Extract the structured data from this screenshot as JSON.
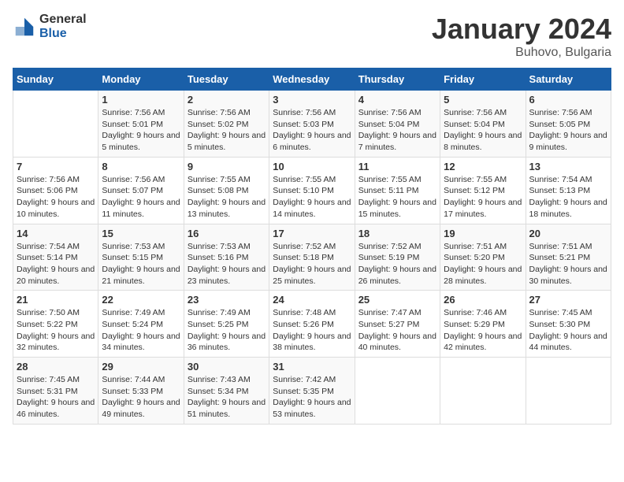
{
  "header": {
    "logo_general": "General",
    "logo_blue": "Blue",
    "month_title": "January 2024",
    "location": "Buhovo, Bulgaria"
  },
  "weekdays": [
    "Sunday",
    "Monday",
    "Tuesday",
    "Wednesday",
    "Thursday",
    "Friday",
    "Saturday"
  ],
  "weeks": [
    [
      {
        "day": "",
        "sunrise": "",
        "sunset": "",
        "daylight": ""
      },
      {
        "day": "1",
        "sunrise": "Sunrise: 7:56 AM",
        "sunset": "Sunset: 5:01 PM",
        "daylight": "Daylight: 9 hours and 5 minutes."
      },
      {
        "day": "2",
        "sunrise": "Sunrise: 7:56 AM",
        "sunset": "Sunset: 5:02 PM",
        "daylight": "Daylight: 9 hours and 5 minutes."
      },
      {
        "day": "3",
        "sunrise": "Sunrise: 7:56 AM",
        "sunset": "Sunset: 5:03 PM",
        "daylight": "Daylight: 9 hours and 6 minutes."
      },
      {
        "day": "4",
        "sunrise": "Sunrise: 7:56 AM",
        "sunset": "Sunset: 5:04 PM",
        "daylight": "Daylight: 9 hours and 7 minutes."
      },
      {
        "day": "5",
        "sunrise": "Sunrise: 7:56 AM",
        "sunset": "Sunset: 5:04 PM",
        "daylight": "Daylight: 9 hours and 8 minutes."
      },
      {
        "day": "6",
        "sunrise": "Sunrise: 7:56 AM",
        "sunset": "Sunset: 5:05 PM",
        "daylight": "Daylight: 9 hours and 9 minutes."
      }
    ],
    [
      {
        "day": "7",
        "sunrise": "Sunrise: 7:56 AM",
        "sunset": "Sunset: 5:06 PM",
        "daylight": "Daylight: 9 hours and 10 minutes."
      },
      {
        "day": "8",
        "sunrise": "Sunrise: 7:56 AM",
        "sunset": "Sunset: 5:07 PM",
        "daylight": "Daylight: 9 hours and 11 minutes."
      },
      {
        "day": "9",
        "sunrise": "Sunrise: 7:55 AM",
        "sunset": "Sunset: 5:08 PM",
        "daylight": "Daylight: 9 hours and 13 minutes."
      },
      {
        "day": "10",
        "sunrise": "Sunrise: 7:55 AM",
        "sunset": "Sunset: 5:10 PM",
        "daylight": "Daylight: 9 hours and 14 minutes."
      },
      {
        "day": "11",
        "sunrise": "Sunrise: 7:55 AM",
        "sunset": "Sunset: 5:11 PM",
        "daylight": "Daylight: 9 hours and 15 minutes."
      },
      {
        "day": "12",
        "sunrise": "Sunrise: 7:55 AM",
        "sunset": "Sunset: 5:12 PM",
        "daylight": "Daylight: 9 hours and 17 minutes."
      },
      {
        "day": "13",
        "sunrise": "Sunrise: 7:54 AM",
        "sunset": "Sunset: 5:13 PM",
        "daylight": "Daylight: 9 hours and 18 minutes."
      }
    ],
    [
      {
        "day": "14",
        "sunrise": "Sunrise: 7:54 AM",
        "sunset": "Sunset: 5:14 PM",
        "daylight": "Daylight: 9 hours and 20 minutes."
      },
      {
        "day": "15",
        "sunrise": "Sunrise: 7:53 AM",
        "sunset": "Sunset: 5:15 PM",
        "daylight": "Daylight: 9 hours and 21 minutes."
      },
      {
        "day": "16",
        "sunrise": "Sunrise: 7:53 AM",
        "sunset": "Sunset: 5:16 PM",
        "daylight": "Daylight: 9 hours and 23 minutes."
      },
      {
        "day": "17",
        "sunrise": "Sunrise: 7:52 AM",
        "sunset": "Sunset: 5:18 PM",
        "daylight": "Daylight: 9 hours and 25 minutes."
      },
      {
        "day": "18",
        "sunrise": "Sunrise: 7:52 AM",
        "sunset": "Sunset: 5:19 PM",
        "daylight": "Daylight: 9 hours and 26 minutes."
      },
      {
        "day": "19",
        "sunrise": "Sunrise: 7:51 AM",
        "sunset": "Sunset: 5:20 PM",
        "daylight": "Daylight: 9 hours and 28 minutes."
      },
      {
        "day": "20",
        "sunrise": "Sunrise: 7:51 AM",
        "sunset": "Sunset: 5:21 PM",
        "daylight": "Daylight: 9 hours and 30 minutes."
      }
    ],
    [
      {
        "day": "21",
        "sunrise": "Sunrise: 7:50 AM",
        "sunset": "Sunset: 5:22 PM",
        "daylight": "Daylight: 9 hours and 32 minutes."
      },
      {
        "day": "22",
        "sunrise": "Sunrise: 7:49 AM",
        "sunset": "Sunset: 5:24 PM",
        "daylight": "Daylight: 9 hours and 34 minutes."
      },
      {
        "day": "23",
        "sunrise": "Sunrise: 7:49 AM",
        "sunset": "Sunset: 5:25 PM",
        "daylight": "Daylight: 9 hours and 36 minutes."
      },
      {
        "day": "24",
        "sunrise": "Sunrise: 7:48 AM",
        "sunset": "Sunset: 5:26 PM",
        "daylight": "Daylight: 9 hours and 38 minutes."
      },
      {
        "day": "25",
        "sunrise": "Sunrise: 7:47 AM",
        "sunset": "Sunset: 5:27 PM",
        "daylight": "Daylight: 9 hours and 40 minutes."
      },
      {
        "day": "26",
        "sunrise": "Sunrise: 7:46 AM",
        "sunset": "Sunset: 5:29 PM",
        "daylight": "Daylight: 9 hours and 42 minutes."
      },
      {
        "day": "27",
        "sunrise": "Sunrise: 7:45 AM",
        "sunset": "Sunset: 5:30 PM",
        "daylight": "Daylight: 9 hours and 44 minutes."
      }
    ],
    [
      {
        "day": "28",
        "sunrise": "Sunrise: 7:45 AM",
        "sunset": "Sunset: 5:31 PM",
        "daylight": "Daylight: 9 hours and 46 minutes."
      },
      {
        "day": "29",
        "sunrise": "Sunrise: 7:44 AM",
        "sunset": "Sunset: 5:33 PM",
        "daylight": "Daylight: 9 hours and 49 minutes."
      },
      {
        "day": "30",
        "sunrise": "Sunrise: 7:43 AM",
        "sunset": "Sunset: 5:34 PM",
        "daylight": "Daylight: 9 hours and 51 minutes."
      },
      {
        "day": "31",
        "sunrise": "Sunrise: 7:42 AM",
        "sunset": "Sunset: 5:35 PM",
        "daylight": "Daylight: 9 hours and 53 minutes."
      },
      {
        "day": "",
        "sunrise": "",
        "sunset": "",
        "daylight": ""
      },
      {
        "day": "",
        "sunrise": "",
        "sunset": "",
        "daylight": ""
      },
      {
        "day": "",
        "sunrise": "",
        "sunset": "",
        "daylight": ""
      }
    ]
  ]
}
